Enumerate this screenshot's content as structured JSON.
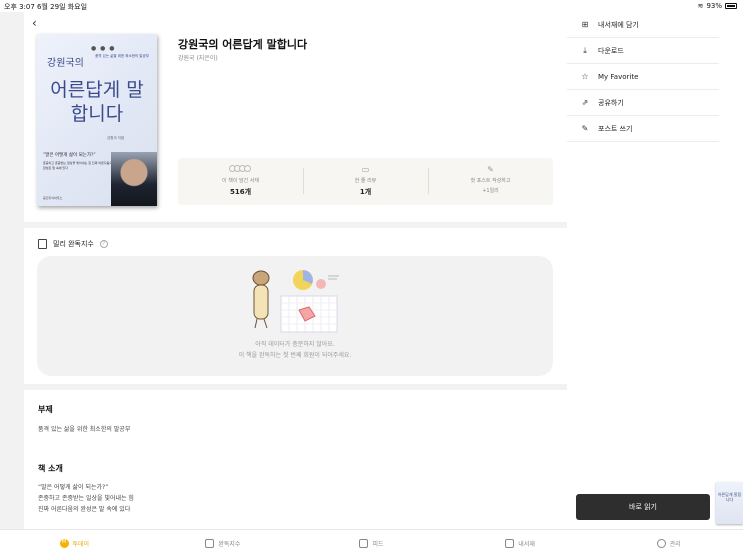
{
  "status_bar": {
    "time_date": "오후 3:07  6월 29일 화요일",
    "battery": "93%"
  },
  "book": {
    "title": "강원국의 어른답게 말합니다",
    "author": "강원국 (지은이)",
    "cover": {
      "author": "강원국의",
      "subtitle": "품격 있는 삶을 위한 최소한의 말공부",
      "title": "어른답게 말합니다",
      "byline": "강원국 지음",
      "quote": "“말은 어떻게 삶이 되는가?”",
      "quote_body": "존중하고 존중받는 일상을 빛어내는 힘 진짜 어른다움의 완성은 말 속에 있다",
      "publisher": "웅진지식하우스"
    }
  },
  "stats": [
    {
      "icon": "readers-icon",
      "label": "이 책이 담긴 서재",
      "value": "516개"
    },
    {
      "icon": "comment-icon",
      "label": "한 줄 리뷰",
      "value": "1개"
    },
    {
      "icon": "edit-icon",
      "label": "첫 포스트 작성하고",
      "value": "+1일리"
    }
  ],
  "millie_index": {
    "title": "밀리 완독지수",
    "empty_line1": "아직 데이터가 충분하지 않아요.",
    "empty_line2": "이 책을 완독하는 첫 번째 회원이 되어주세요."
  },
  "subtitle_section": {
    "heading": "부제",
    "text": "품격 있는 삶을 위한 최소한의 말공부"
  },
  "intro_section": {
    "heading": "책 소개",
    "lines": [
      "“말은 어떻게 삶이 되는가?”",
      "존중하고 존중받는 일상을 빛어내는 힘",
      "진짜 어른다움의 완성은 말 속에 있다"
    ]
  },
  "side_menu": [
    {
      "icon": "library-add-icon",
      "label": "내서재에 담기"
    },
    {
      "icon": "download-icon",
      "label": "다운로드"
    },
    {
      "icon": "star-icon",
      "label": "My Favorite"
    },
    {
      "icon": "share-icon",
      "label": "공유하기"
    },
    {
      "icon": "write-post-icon",
      "label": "포스트 쓰기"
    }
  ],
  "read_button": "바로 읽기",
  "tabs": [
    {
      "icon": "today-icon",
      "label": "투데이",
      "active": true,
      "glyph": "M"
    },
    {
      "icon": "index-icon",
      "label": "완독지수",
      "active": false,
      "glyph": ""
    },
    {
      "icon": "feed-icon",
      "label": "피드",
      "active": false,
      "glyph": ""
    },
    {
      "icon": "library-icon",
      "label": "내서재",
      "active": false,
      "glyph": ""
    },
    {
      "icon": "profile-icon",
      "label": "관리",
      "active": false,
      "glyph": ""
    }
  ],
  "colors": {
    "accent": "#f3b400",
    "button": "#2e2e2e",
    "stats_bg": "#f7f6f2"
  }
}
